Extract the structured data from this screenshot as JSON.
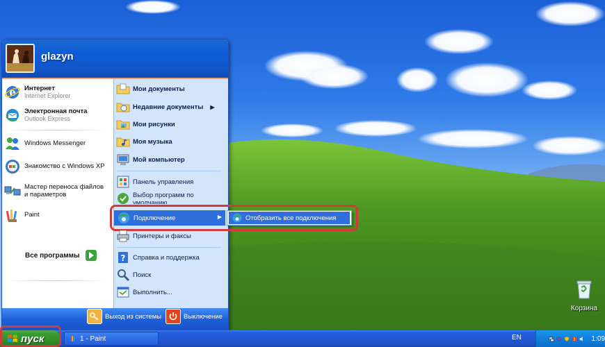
{
  "user": {
    "name": "glazyn"
  },
  "start_menu": {
    "left_items": [
      {
        "title": "Интернет",
        "subtitle": "Internet Explorer",
        "icon": "internet-explorer-icon"
      },
      {
        "title": "Электронная почта",
        "subtitle": "Outlook Express",
        "icon": "outlook-express-icon"
      },
      {
        "title": "Windows Messenger",
        "icon": "messenger-icon"
      },
      {
        "title": "Знакомство с Windows XP",
        "icon": "tour-icon"
      },
      {
        "title": "Мастер переноса файлов и параметров",
        "icon": "transfer-wizard-icon"
      },
      {
        "title": "Paint",
        "icon": "paint-icon"
      }
    ],
    "all_programs": "Все программы",
    "right_items": [
      {
        "label": "Мои документы",
        "icon": "folder-icon"
      },
      {
        "label": "Недавние документы",
        "icon": "recent-icon"
      },
      {
        "label": "Мои рисунки",
        "icon": "pictures-icon"
      },
      {
        "label": "Моя музыка",
        "icon": "music-icon"
      },
      {
        "label": "Мой компьютер",
        "icon": "computer-icon"
      },
      {
        "label": "Панель управления",
        "icon": "control-panel-icon"
      },
      {
        "label": "Выбор программ по умолчанию",
        "icon": "default-programs-icon"
      },
      {
        "label": "Подключение",
        "icon": "network-icon"
      },
      {
        "label": "Принтеры и факсы",
        "icon": "printer-icon"
      },
      {
        "label": "Справка и поддержка",
        "icon": "help-icon"
      },
      {
        "label": "Поиск",
        "icon": "search-icon"
      },
      {
        "label": "Выполнить...",
        "icon": "run-icon"
      }
    ],
    "submenu_item": "Отобразить все подключения",
    "footer": {
      "logoff": "Выход из системы",
      "shutdown": "Выключение"
    }
  },
  "desktop": {
    "recycle_bin": "Корзина"
  },
  "taskbar": {
    "start": "пуск",
    "task": "1 - Paint",
    "lang": "EN",
    "clock": "1:09"
  },
  "colors": {
    "highlight": "#2f6fdc",
    "annotation": "#d23b3b",
    "start_green": "#3c9e35"
  }
}
